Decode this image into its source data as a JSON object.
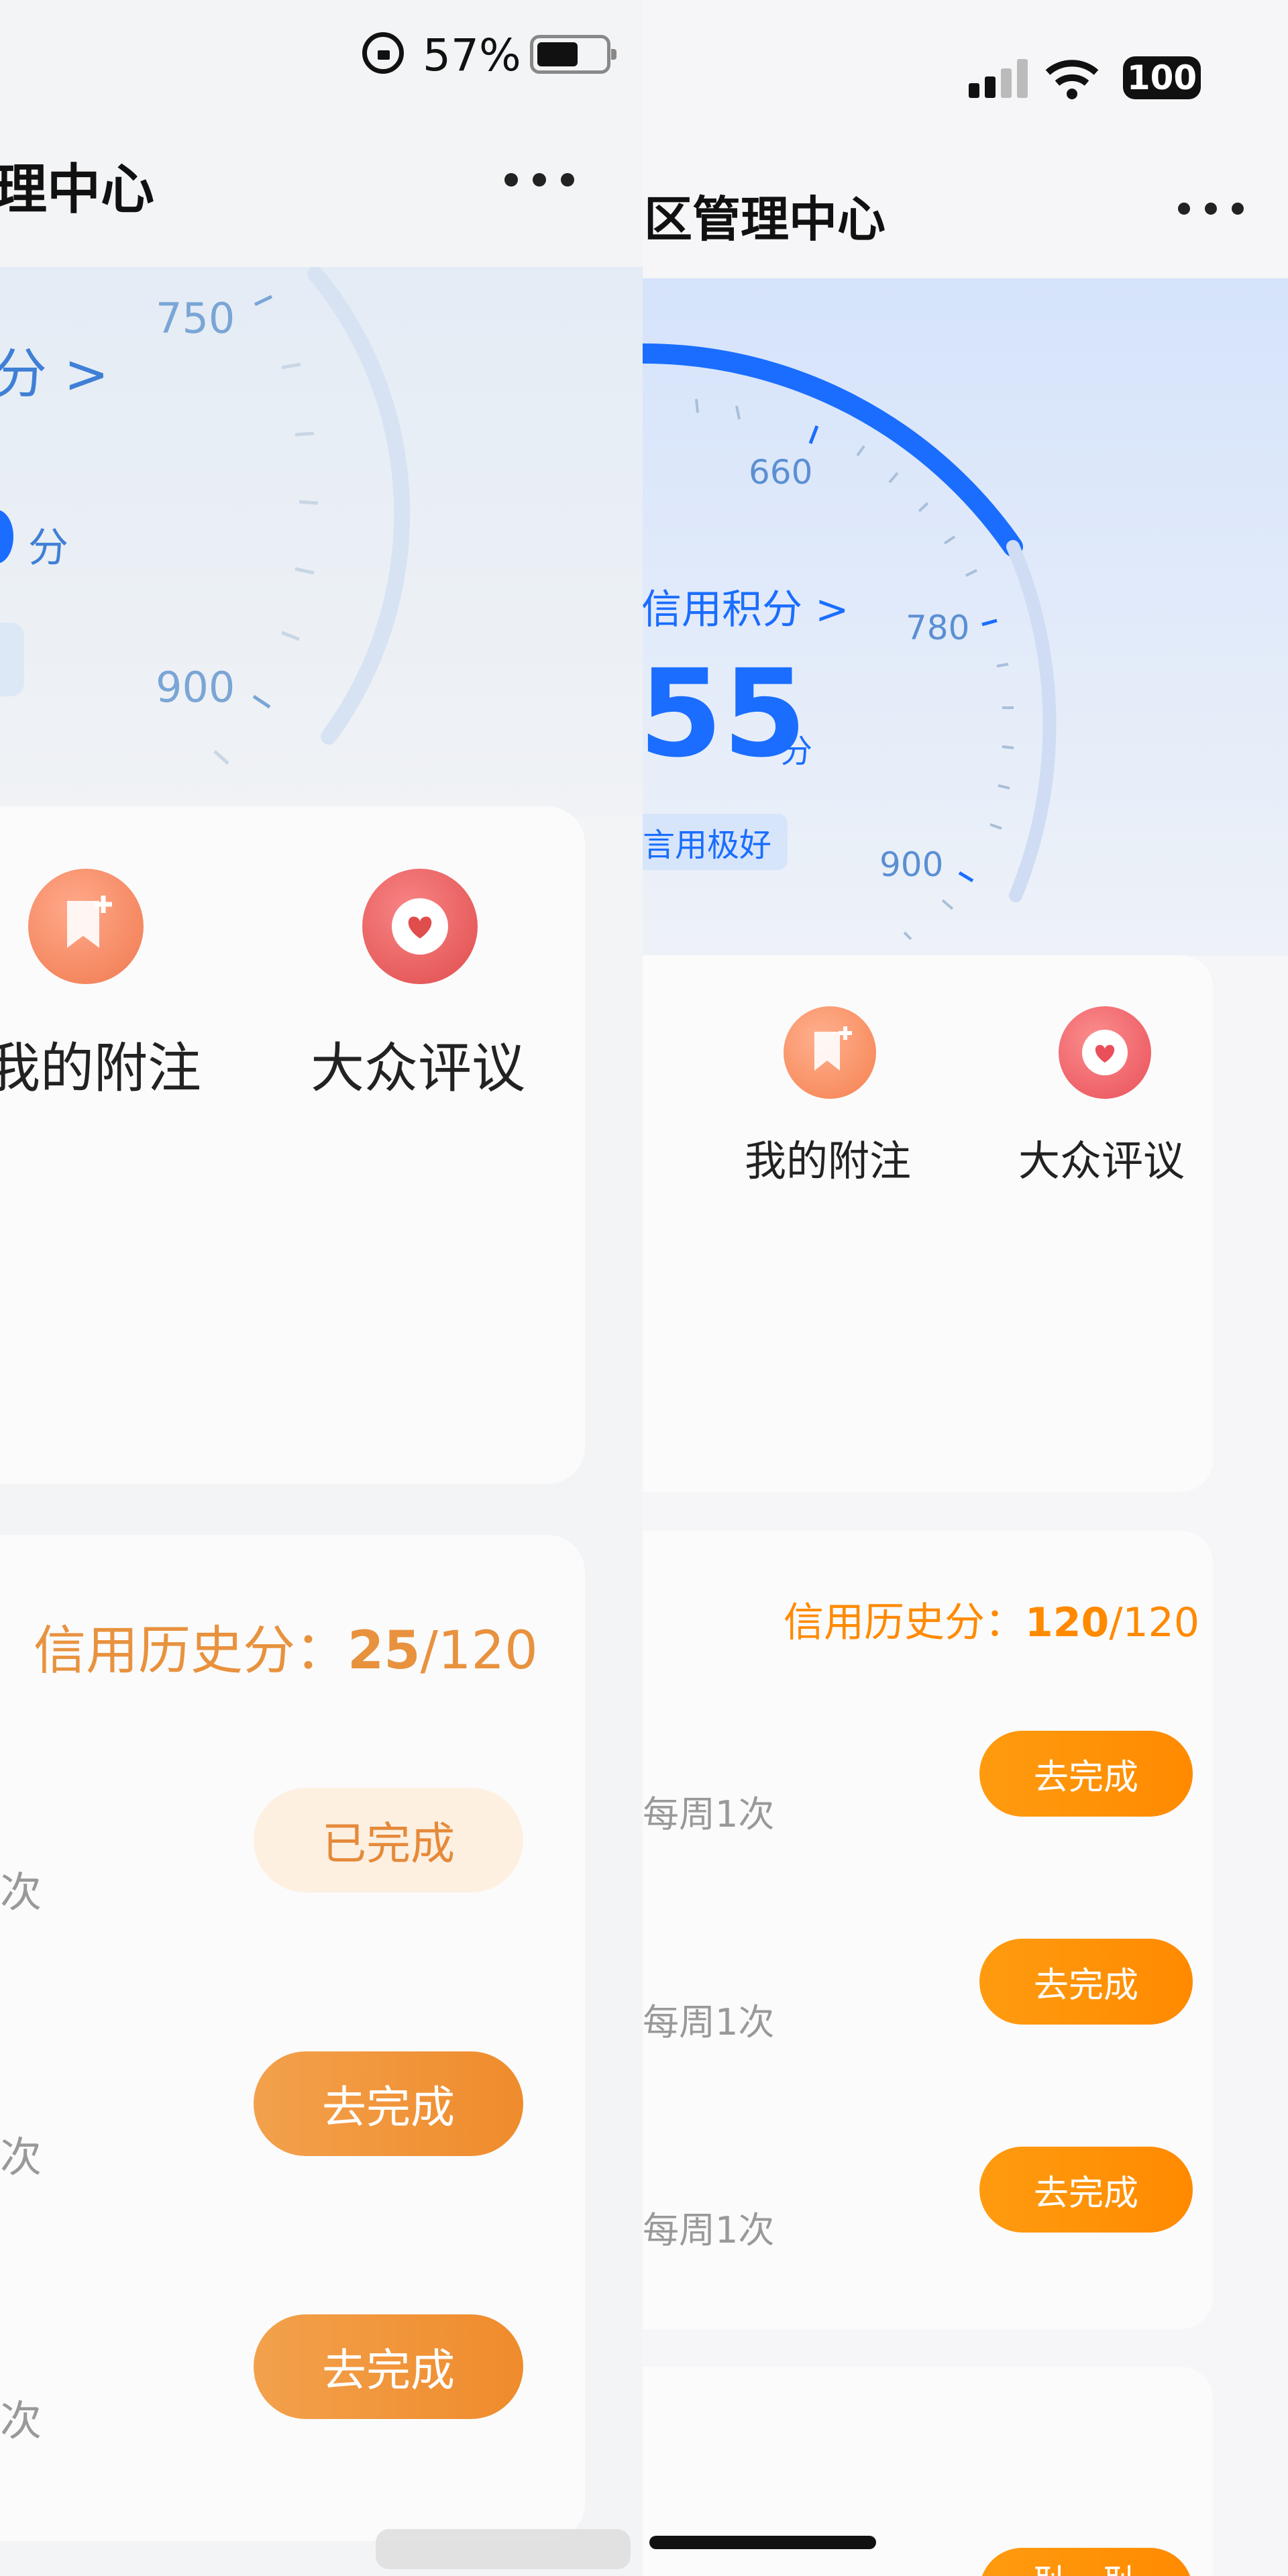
{
  "left": {
    "status": {
      "battery_text": "57%"
    },
    "header": {
      "title": "理中心"
    },
    "gauge": {
      "ticks": [
        "750",
        "900"
      ],
      "score_link": "分 >",
      "unit": "分"
    },
    "shortcuts": [
      {
        "label": "我的附注",
        "icon": "bookmark-add-icon"
      },
      {
        "label": "大众评议",
        "icon": "heart-chat-icon"
      }
    ],
    "history": {
      "label": "信用历史分：",
      "value": "25",
      "total": "/120",
      "tasks": [
        {
          "freq": "次",
          "button": "已完成"
        },
        {
          "freq": "次",
          "button": "去完成"
        },
        {
          "freq": "次",
          "button": "去完成"
        }
      ]
    }
  },
  "right": {
    "status": {
      "battery_text": "100"
    },
    "header": {
      "title": "区管理中心"
    },
    "gauge": {
      "ticks": [
        "660",
        "780",
        "900"
      ],
      "score_link": "信用积分 >",
      "score_value": "55",
      "unit": "分",
      "level_badge": "言用极好",
      "arc_color": "#1a6dff"
    },
    "shortcuts": [
      {
        "label": "我的附注",
        "icon": "bookmark-add-icon"
      },
      {
        "label": "大众评议",
        "icon": "heart-chat-icon"
      }
    ],
    "history": {
      "label": "信用历史分：",
      "value": "120",
      "total": "/120",
      "tasks": [
        {
          "freq": "每周1次",
          "button": "去完成"
        },
        {
          "freq": "每周1次",
          "button": "去完成"
        },
        {
          "freq": "每周1次",
          "button": "去完成"
        }
      ]
    },
    "next_button_partial": "耻一耻"
  },
  "colors": {
    "accent_orange": "#ff8a00",
    "accent_blue": "#1a6dff"
  }
}
